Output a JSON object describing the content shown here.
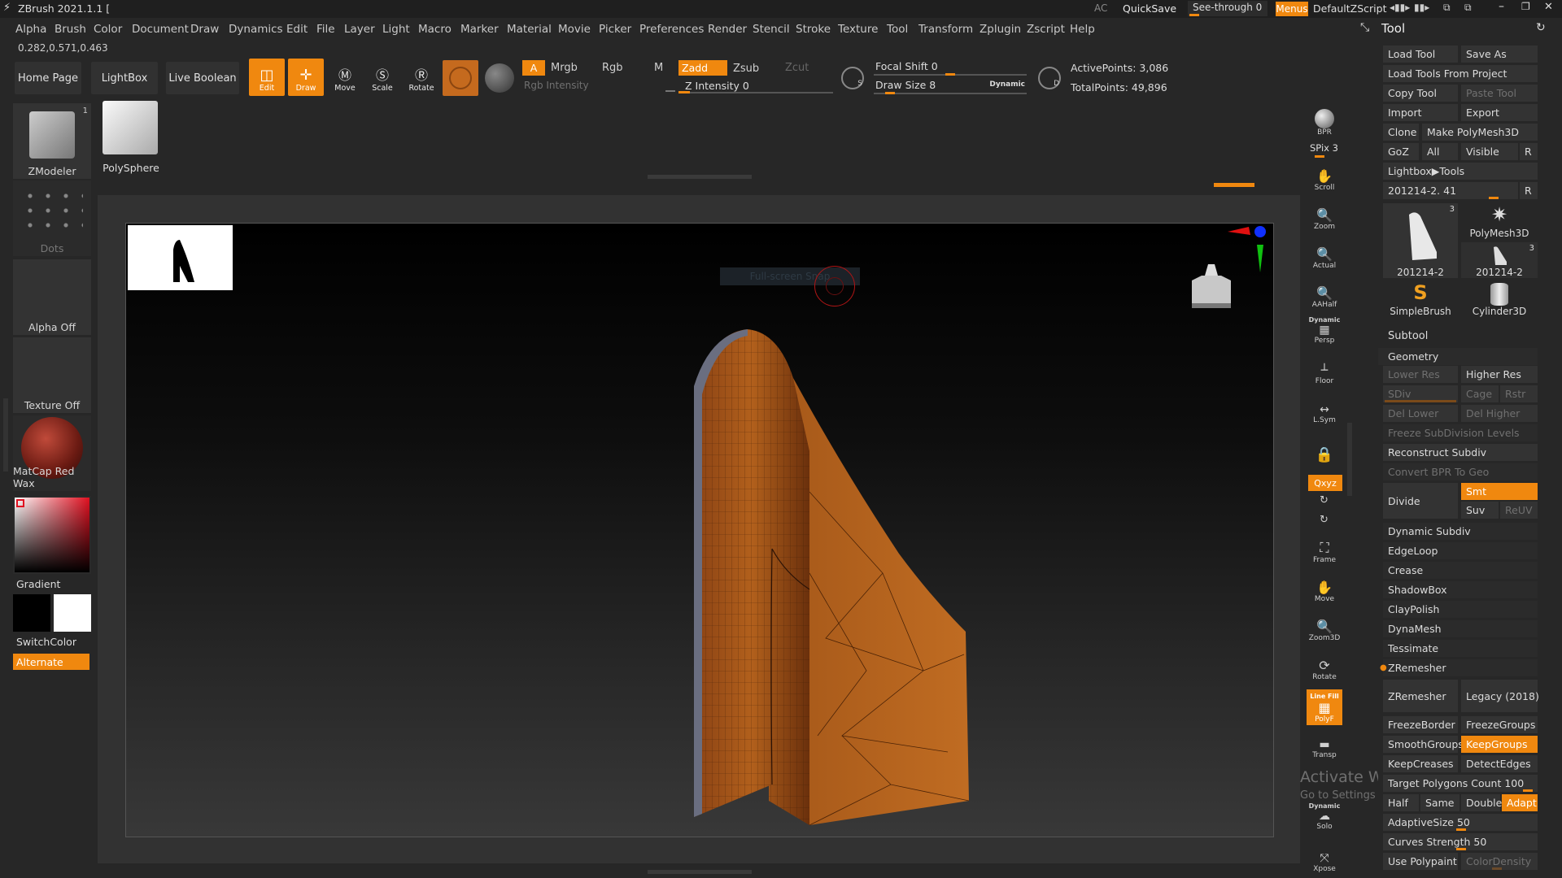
{
  "app": {
    "title": "ZBrush 2021.1.1 ["
  },
  "topright": {
    "ac": "AC",
    "quicksave": "QuickSave",
    "see_through": "See-through  0",
    "menus": "Menus",
    "script": "DefaultZScript"
  },
  "menus": [
    "Alpha",
    "Brush",
    "Color",
    "Document",
    "Draw",
    "Dynamics",
    "Edit",
    "File",
    "Layer",
    "Light",
    "Macro",
    "Marker",
    "Material",
    "Movie",
    "Picker",
    "Preferences",
    "Render",
    "Stencil",
    "Stroke",
    "Texture",
    "Tool",
    "Transform",
    "Zplugin",
    "Zscript",
    "Help"
  ],
  "coords": "0.282,0.571,0.463",
  "shelf": {
    "home": "Home Page",
    "lightbox": "LightBox",
    "live_boolean": "Live Boolean"
  },
  "transform_tools": [
    {
      "label": "Edit",
      "active": true
    },
    {
      "label": "Draw",
      "active": true
    },
    {
      "label": "Move",
      "active": false
    },
    {
      "label": "Scale",
      "active": false
    },
    {
      "label": "Rotate",
      "active": false
    }
  ],
  "brush_modes": {
    "a": "A",
    "mrgb": "Mrgb",
    "rgb": "Rgb",
    "m": "M",
    "zadd": "Zadd",
    "zsub": "Zsub",
    "zcut": "Zcut"
  },
  "intensity": {
    "rgb": "Rgb Intensity",
    "z": "Z Intensity 0"
  },
  "focal": {
    "shift": "Focal Shift 0",
    "draw_size": "Draw Size 8",
    "dynamic": "Dynamic"
  },
  "points": {
    "active": "ActivePoints: 3,086",
    "total": "TotalPoints: 49,896"
  },
  "left": {
    "zmodeler": "ZModeler",
    "zmodeler_count": "1",
    "polysphere": "PolySphere",
    "dots": "Dots",
    "alpha": "Alpha Off",
    "texture": "Texture Off",
    "material": "MatCap Red Wax",
    "gradient": "Gradient",
    "switch": "SwitchColor",
    "alternate": "Alternate"
  },
  "canvas": {
    "tooltip": "Full-screen Snap"
  },
  "rail": {
    "bpr": "BPR",
    "spix": "SPix 3",
    "items": [
      "Scroll",
      "Zoom",
      "Actual",
      "AAHalf",
      "Persp",
      "Floor",
      "L.Sym",
      "",
      "Frame",
      "Move",
      "Zoom3D",
      "Rotate",
      "PolyF",
      "Transp",
      "Solo",
      "Xpose"
    ],
    "dynamic": "Dynamic",
    "xyz": "Qxyz",
    "line_fill": "Line Fill"
  },
  "tool_panel": {
    "title": "Tool",
    "load_tool": "Load Tool",
    "save_as": "Save As",
    "load_from_project": "Load Tools From Project",
    "copy_tool": "Copy Tool",
    "paste_tool": "Paste Tool",
    "import": "Import",
    "export": "Export",
    "clone": "Clone",
    "make_polymesh": "Make PolyMesh3D",
    "goz": "GoZ",
    "all": "All",
    "visible": "Visible",
    "r": "R",
    "lightbox_tools": "Lightbox▶Tools",
    "current_tool": "201214-2. 41",
    "thumbs": [
      {
        "label": "201214-2",
        "count": "3"
      },
      {
        "label": "PolyMesh3D",
        "count": ""
      },
      {
        "label": "201214-2",
        "count": "3"
      },
      {
        "label": "SimpleBrush",
        "count": ""
      },
      {
        "label": "Cylinder3D",
        "count": ""
      }
    ],
    "subtool": "Subtool",
    "geometry": "Geometry",
    "lower_res": "Lower Res",
    "higher_res": "Higher Res",
    "sdiv": "SDiv",
    "cage": "Cage",
    "rstr": "Rstr",
    "del_lower": "Del Lower",
    "del_higher": "Del Higher",
    "freeze_subdiv": "Freeze SubDivision Levels",
    "reconstruct": "Reconstruct Subdiv",
    "convert_bpr": "Convert BPR To Geo",
    "divide": "Divide",
    "smt": "Smt",
    "suv": "Suv",
    "reuv": "ReUV",
    "dynamic_subdiv": "Dynamic Subdiv",
    "edgeloop": "EdgeLoop",
    "crease": "Crease",
    "shadowbox": "ShadowBox",
    "claypolish": "ClayPolish",
    "dynamesh": "DynaMesh",
    "tessimate": "Tessimate",
    "zremesher_header": "ZRemesher",
    "zremesher": "ZRemesher",
    "legacy": "Legacy (2018)",
    "freeze_border": "FreezeBorder",
    "freeze_groups": "FreezeGroups",
    "smooth_groups": "SmoothGroups",
    "keep_groups": "KeepGroups",
    "keep_creases": "KeepCreases",
    "detect_edges": "DetectEdges",
    "target_polys": "Target Polygons Count 100",
    "half": "Half",
    "same": "Same",
    "double": "Double",
    "adapt": "Adapt",
    "adaptive_size": "AdaptiveSize 50",
    "curves_strength": "Curves Strength 50",
    "use_polypaint": "Use Polypaint",
    "color_density": "ColorDensity"
  },
  "watermark": {
    "line1": "Activate Windows",
    "line2": "Go to Settings to activate Windows."
  },
  "colors": {
    "accent": "#f0880f",
    "panel": "#333333",
    "bg": "#272727",
    "mesh": "#a85a1a"
  }
}
